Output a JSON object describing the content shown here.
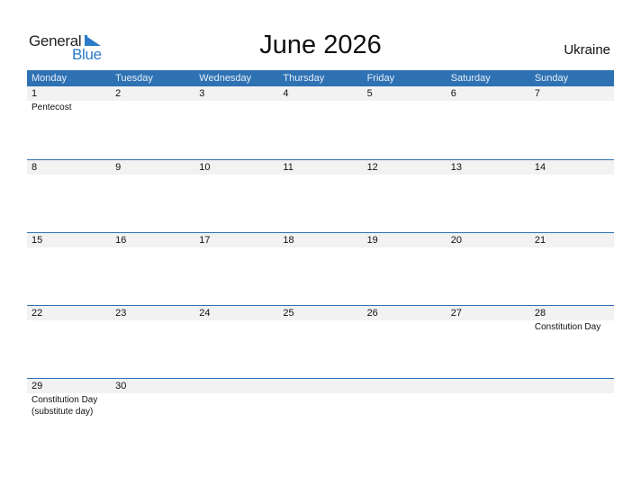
{
  "logo": {
    "general": "General",
    "blue": "Blue",
    "accent_color": "#2a7bc8"
  },
  "title": "June 2026",
  "country": "Ukraine",
  "header_color": "#2e72b4",
  "weekdays": [
    "Monday",
    "Tuesday",
    "Wednesday",
    "Thursday",
    "Friday",
    "Saturday",
    "Sunday"
  ],
  "weeks": [
    {
      "days": [
        {
          "date": "1",
          "event": "Pentecost"
        },
        {
          "date": "2",
          "event": ""
        },
        {
          "date": "3",
          "event": ""
        },
        {
          "date": "4",
          "event": ""
        },
        {
          "date": "5",
          "event": ""
        },
        {
          "date": "6",
          "event": ""
        },
        {
          "date": "7",
          "event": ""
        }
      ]
    },
    {
      "days": [
        {
          "date": "8",
          "event": ""
        },
        {
          "date": "9",
          "event": ""
        },
        {
          "date": "10",
          "event": ""
        },
        {
          "date": "11",
          "event": ""
        },
        {
          "date": "12",
          "event": ""
        },
        {
          "date": "13",
          "event": ""
        },
        {
          "date": "14",
          "event": ""
        }
      ]
    },
    {
      "days": [
        {
          "date": "15",
          "event": ""
        },
        {
          "date": "16",
          "event": ""
        },
        {
          "date": "17",
          "event": ""
        },
        {
          "date": "18",
          "event": ""
        },
        {
          "date": "19",
          "event": ""
        },
        {
          "date": "20",
          "event": ""
        },
        {
          "date": "21",
          "event": ""
        }
      ]
    },
    {
      "days": [
        {
          "date": "22",
          "event": ""
        },
        {
          "date": "23",
          "event": ""
        },
        {
          "date": "24",
          "event": ""
        },
        {
          "date": "25",
          "event": ""
        },
        {
          "date": "26",
          "event": ""
        },
        {
          "date": "27",
          "event": ""
        },
        {
          "date": "28",
          "event": "Constitution Day"
        }
      ]
    },
    {
      "days": [
        {
          "date": "29",
          "event": "Constitution Day (substitute day)"
        },
        {
          "date": "30",
          "event": ""
        },
        {
          "date": "",
          "event": ""
        },
        {
          "date": "",
          "event": ""
        },
        {
          "date": "",
          "event": ""
        },
        {
          "date": "",
          "event": ""
        },
        {
          "date": "",
          "event": ""
        }
      ]
    }
  ]
}
